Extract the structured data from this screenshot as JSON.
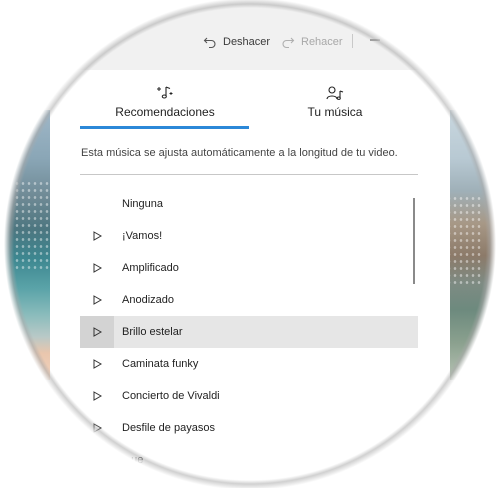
{
  "toolbar": {
    "undo_label": "Deshacer",
    "redo_label": "Rehacer",
    "undo_icon": "undo-icon",
    "redo_icon": "redo-icon"
  },
  "tabs": [
    {
      "label": "Recomendaciones",
      "icon": "sparkle-music-icon",
      "selected": true
    },
    {
      "label": "Tu música",
      "icon": "user-music-icon",
      "selected": false
    }
  ],
  "description": "Esta música se ajusta automáticamente a la longitud de tu video.",
  "tracks": [
    {
      "label": "Ninguna",
      "has_play": false
    },
    {
      "label": "¡Vamos!",
      "has_play": true
    },
    {
      "label": "Amplificado",
      "has_play": true
    },
    {
      "label": "Anodizado",
      "has_play": true
    },
    {
      "label": "Brillo estelar",
      "has_play": true,
      "selected": true
    },
    {
      "label": "Caminata funky",
      "has_play": true
    },
    {
      "label": "Concierto de Vivaldi",
      "has_play": true
    },
    {
      "label": "Desfile de payasos",
      "has_play": true
    },
    {
      "label": "...ue",
      "has_play": true
    }
  ],
  "colors": {
    "accent": "#2b88d8",
    "selected_row": "#e6e6e6",
    "text": "#1f1f1f"
  }
}
